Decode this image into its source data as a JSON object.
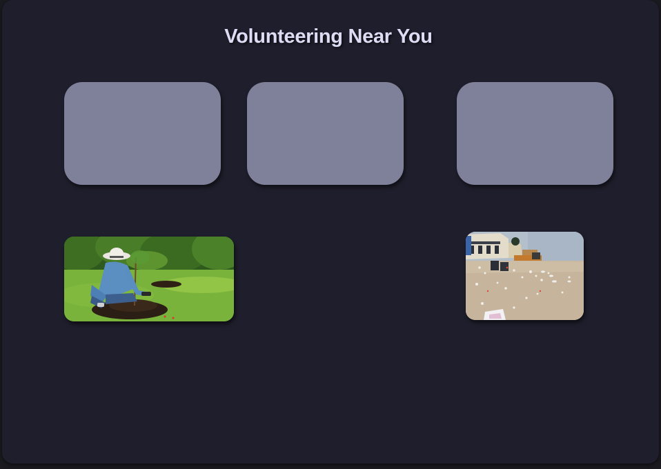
{
  "page": {
    "title": "Volunteering Near You"
  },
  "cards": [
    {
      "color": "#7e8199"
    },
    {
      "color": "#7e8199"
    },
    {
      "color": "#7e8199"
    }
  ],
  "photos": [
    {
      "icon": "tree-planting-photo"
    },
    {
      "icon": "beach-litter-photo"
    }
  ],
  "colors": {
    "background": "#1f1e2c",
    "title": "#dcdcf4",
    "card": "#7e8199"
  }
}
